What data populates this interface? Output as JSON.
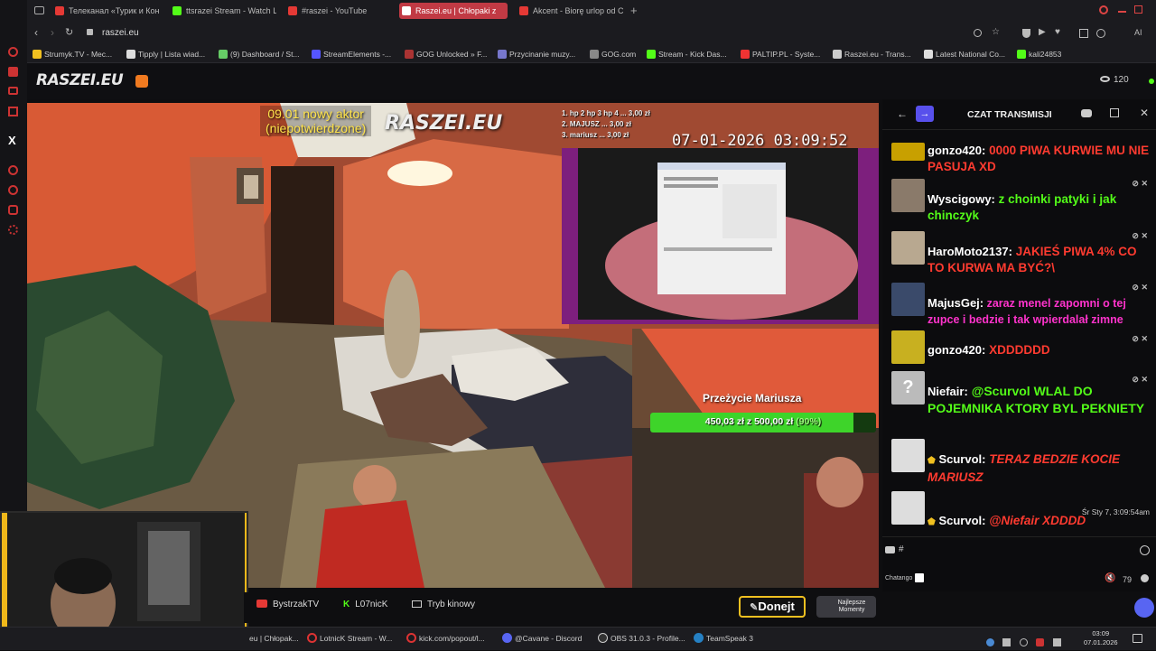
{
  "tabs": [
    {
      "label": "Телеканал «Турик и Коня",
      "color": "#e53935"
    },
    {
      "label": "ttsrazei Stream - Watch L",
      "color": "#53fc18"
    },
    {
      "label": "#raszei - YouTube",
      "color": "#e53935"
    },
    {
      "label": "Raszei.eu | Chłopaki z",
      "color": "#ffffff",
      "active": true
    },
    {
      "label": "Akcent - Biorę urlop od Ci",
      "color": "#e53935"
    }
  ],
  "url": "raszei.eu",
  "bookmarks": [
    "Strumyk.TV - Mec...",
    "Tipply | Lista wiad...",
    "(9) Dashboard / St...",
    "StreamElements -...",
    "GOG Unlocked » F...",
    "Przycinanie muzy...",
    "GOG.com",
    "Stream - Kick Das...",
    "PALTIP.PL - Syste...",
    "Raszei.eu - Trans...",
    "Latest National Co...",
    "kali24853"
  ],
  "site": {
    "logo": "RASZEI.EU",
    "viewers": "120"
  },
  "overlay": {
    "announcement_line1": "09.01 nowy aktor",
    "announcement_line2": "(niepotwierdzone)",
    "watermark": "RASZEI.EU",
    "ranking_line1": "1. hp 2 hp 3 hp 4 ... 3,00 zł",
    "ranking_line2": "2. MAJUSZ ... 3,00 zł",
    "ranking_line3": "3. mariusz ... 3,00 zł",
    "timestamp": "07-01-2026 03:09:52",
    "goal_title": "Przeżycie Mariusza",
    "goal_text": "450,03 zł z 500,00 zł",
    "goal_percent_label": "(90%)",
    "goal_fraction": 0.9
  },
  "chat": {
    "title": "CZAT TRANSMISJI",
    "messages": [
      {
        "user": "gonzo420:",
        "text": "0000 PIWA KURWIE MU NIE PASUJA XD",
        "color": "#ff3b30"
      },
      {
        "user": "Wyscigowy:",
        "text": "z choinki patyki i jak chinczyk",
        "color": "#53fc18"
      },
      {
        "user": "HaroMoto2137:",
        "text": "JAKIEŚ PIWA 4% CO TO KURWA MA BYĆ?\\",
        "color": "#ff3b30"
      },
      {
        "user": "MajusGej:",
        "text": "zaraz menel zapomni o tej zupce i bedzie i tak wpierdalał zimne",
        "color": "#ff33cc"
      },
      {
        "user": "gonzo420:",
        "text": "XDDDDDD",
        "color": "#ff3b30"
      },
      {
        "user": "Niefair:",
        "text": "@Scurvol WLAL DO POJEMNIKA KTORY BYL PEKNIETY",
        "color": "#53fc18"
      },
      {
        "user": "Scurvol:",
        "text": "TERAZ BEDZIE KOCIE MARIUSZ",
        "color": "#ff3b30"
      },
      {
        "user": "Scurvol:",
        "text": "@Niefair XDDDD",
        "color": "#ff3b30",
        "time": "Śr Sty 7, 3:09:54am"
      }
    ],
    "input_prefix": "#",
    "footer_label": "Chatango",
    "volume": "79"
  },
  "underbar": {
    "btn1": "BystrzakTV",
    "btn2": "L07nicK",
    "btn3": "Tryb kinowy",
    "donate": "Donejt",
    "moments": "Najlepsze Momenty"
  },
  "taskbar": {
    "items": [
      "eu | Chłopak...",
      "LotnicK Stream - W...",
      "kick.com/popout/l...",
      "@Cavane - Discord",
      "OBS 31.0.3 - Profile...",
      "TeamSpeak 3"
    ],
    "time": "03:09",
    "date": "07.01.2026"
  }
}
